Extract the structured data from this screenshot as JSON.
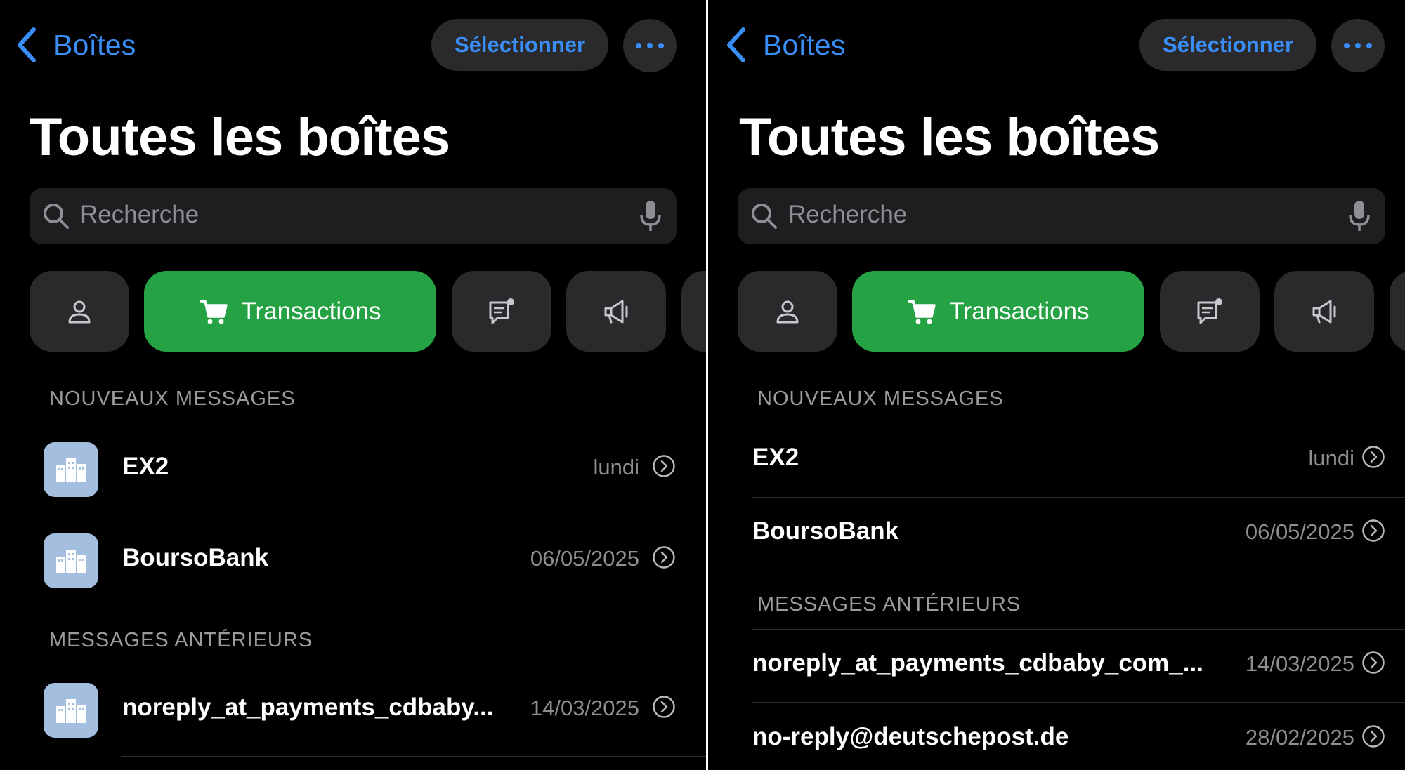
{
  "nav": {
    "back_label": "Boîtes",
    "select_label": "Sélectionner"
  },
  "page_title": "Toutes les boîtes",
  "search": {
    "placeholder": "Recherche"
  },
  "filters": {
    "active_label": "Transactions",
    "active_color": "#25a244"
  },
  "accent_color": "#3a8ef8",
  "sections": {
    "new": "NOUVEAUX MESSAGES",
    "older": "MESSAGES ANTÉRIEURS"
  },
  "left": {
    "messages": [
      {
        "name": "EX2",
        "date": "lundi"
      },
      {
        "name": "BoursoBank",
        "date": "06/05/2025"
      },
      {
        "name": "noreply_at_payments_cdbaby...",
        "date": "14/03/2025"
      }
    ]
  },
  "right": {
    "messages": [
      {
        "name": "EX2",
        "date": "lundi"
      },
      {
        "name": "BoursoBank",
        "date": "06/05/2025"
      },
      {
        "name": "noreply_at_payments_cdbaby_com_...",
        "date": "14/03/2025"
      },
      {
        "name": "no-reply@deutschepost.de",
        "date": "28/02/2025"
      }
    ]
  },
  "icons": {
    "back": "chevron-left-icon",
    "more": "ellipsis-icon",
    "search": "magnifier-icon",
    "mic": "microphone-icon",
    "person": "person-icon",
    "cart": "cart-icon",
    "chat": "chat-bubble-icon",
    "megaphone": "megaphone-icon",
    "building": "building-icon",
    "disclosure": "chevron-right-circle-icon"
  }
}
